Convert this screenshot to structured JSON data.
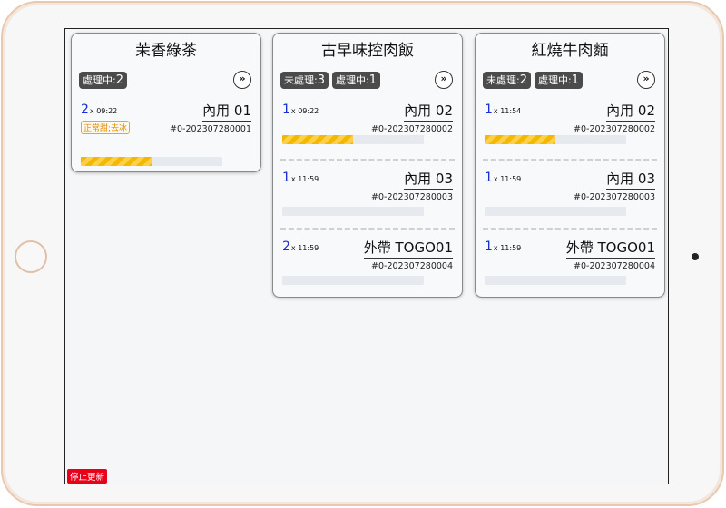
{
  "stop_button_label": "停止更新",
  "cards": [
    {
      "title": "茉香綠茶",
      "badges": [
        {
          "label": "處理中:",
          "count": "2"
        }
      ],
      "orders": [
        {
          "qty": "2",
          "time": "09:22",
          "table": "內用 01",
          "order_no": "#0-202307280001",
          "note": "正常甜;去冰",
          "progress": 0.5
        }
      ]
    },
    {
      "title": "古早味控肉飯",
      "badges": [
        {
          "label": "未處理:",
          "count": "3"
        },
        {
          "label": "處理中:",
          "count": "1"
        }
      ],
      "orders": [
        {
          "qty": "1",
          "time": "09:22",
          "table": "內用 02",
          "order_no": "#0-202307280002",
          "progress": 0.5
        },
        {
          "qty": "1",
          "time": "11:59",
          "table": "內用 03",
          "order_no": "#0-202307280003",
          "progress": 0
        },
        {
          "qty": "2",
          "time": "11:59",
          "table": "外帶 TOGO01",
          "order_no": "#0-202307280004",
          "progress": 0
        }
      ]
    },
    {
      "title": "紅燒牛肉麵",
      "badges": [
        {
          "label": "未處理:",
          "count": "2"
        },
        {
          "label": "處理中:",
          "count": "1"
        }
      ],
      "orders": [
        {
          "qty": "1",
          "time": "11:54",
          "table": "內用 02",
          "order_no": "#0-202307280002",
          "progress": 0.5
        },
        {
          "qty": "1",
          "time": "11:59",
          "table": "內用 03",
          "order_no": "#0-202307280003",
          "progress": 0
        },
        {
          "qty": "1",
          "time": "11:59",
          "table": "外帶 TOGO01",
          "order_no": "#0-202307280004",
          "progress": 0
        }
      ]
    }
  ],
  "next_icon": "double-chevron-right-icon",
  "colors": {
    "qty": "#1a2fd0",
    "progress_fill": "#f5b800",
    "note": "#e08a00",
    "stop_button": "#e8001a",
    "badge": "#4b4b4b"
  }
}
